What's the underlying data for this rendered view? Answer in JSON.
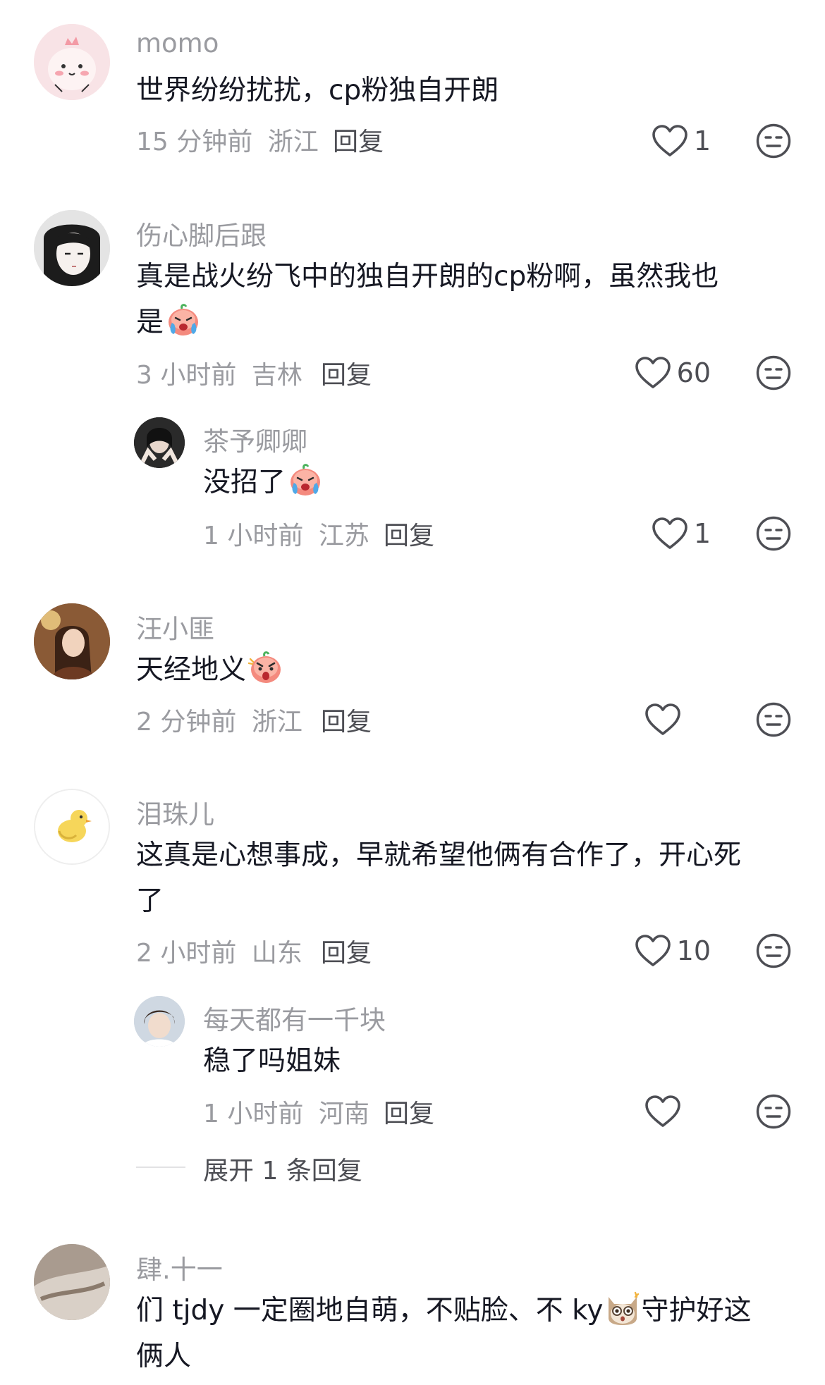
{
  "comments": [
    {
      "username": "momo",
      "text": "世界纷纷扰扰，cp粉独自开朗",
      "time": "15 分钟前",
      "location": "浙江",
      "reply_label": "回复",
      "likes": "1"
    },
    {
      "username": "伤心脚后跟",
      "text_line1": "真是战火纷飞中的独自开朗的cp粉啊，虽然我也",
      "text_line2": "是",
      "time": "3 小时前",
      "location": "吉林",
      "reply_label": "回复",
      "likes": "60",
      "replies": [
        {
          "username": "茶予卿卿",
          "text": "没招了",
          "time": "1 小时前",
          "location": "江苏",
          "reply_label": "回复",
          "likes": "1"
        }
      ]
    },
    {
      "username": "汪小匪",
      "text": "天经地义",
      "time": "2 分钟前",
      "location": "浙江",
      "reply_label": "回复",
      "likes": ""
    },
    {
      "username": "泪珠儿",
      "text_line1": "这真是心想事成，早就希望他俩有合作了，开心死",
      "text_line2": "了",
      "time": "2 小时前",
      "location": "山东",
      "reply_label": "回复",
      "likes": "10",
      "replies": [
        {
          "username": "每天都有一千块",
          "text": "稳了吗姐妹",
          "time": "1 小时前",
          "location": "河南",
          "reply_label": "回复",
          "likes": ""
        }
      ],
      "expand_label": "展开 1 条回复"
    },
    {
      "username": "肆.十一",
      "text_line1a": "们 tjdy 一定圈地自萌，不贴脸、不 ky",
      "text_line1b": "守护好这",
      "text_line2": "俩人"
    }
  ],
  "icons": {
    "like": "heart-outline-icon",
    "dislike": "neutral-face-icon",
    "emoji_cry": "crying-face-emoji",
    "emoji_shout": "shouting-face-emoji",
    "emoji_cat": "shocked-cat-emoji"
  },
  "colors": {
    "text_primary": "#161823",
    "text_secondary": "#9a9ba0",
    "text_action": "#4d4e54",
    "background": "#ffffff"
  }
}
